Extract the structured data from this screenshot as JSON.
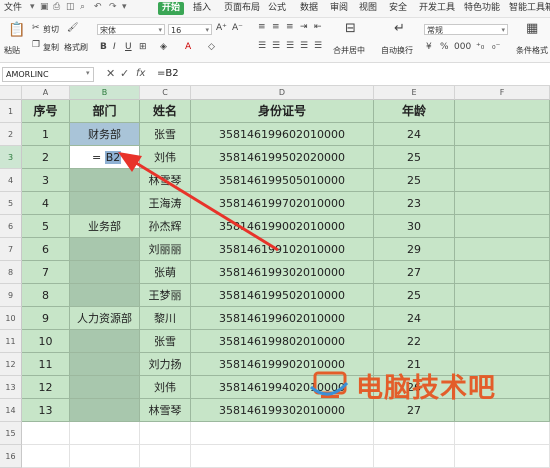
{
  "menubar": {
    "items": [
      "文件",
      "开始",
      "插入",
      "页面布局",
      "公式",
      "数据",
      "审阅",
      "视图",
      "安全",
      "开发工具",
      "特色功能",
      "智能工具箱"
    ],
    "active": "开始"
  },
  "ribbon": {
    "cut": "剪切",
    "copy": "复制",
    "paste": "粘贴",
    "format_painter": "格式刷",
    "font_name": "宋体",
    "font_size": "16",
    "merge_center": "合并居中",
    "wrap_text": "自动换行",
    "number_format": "常规",
    "conditional_format": "条件格式"
  },
  "formula_bar": {
    "name_box": "AMORLINC",
    "fx": "fx",
    "formula": "=B2"
  },
  "columns": [
    "A",
    "B",
    "C",
    "D",
    "E",
    "F"
  ],
  "rows": [
    "1",
    "2",
    "3",
    "4",
    "5",
    "6",
    "7",
    "8",
    "9",
    "10",
    "11",
    "12",
    "13",
    "14",
    "15",
    "16"
  ],
  "table": {
    "headers": [
      "序号",
      "部门",
      "姓名",
      "身份证号",
      "年龄"
    ],
    "seq": [
      "1",
      "2",
      "3",
      "4",
      "5",
      "6",
      "7",
      "8",
      "9",
      "10",
      "11",
      "12",
      "13"
    ],
    "dept": [
      "财务部",
      "",
      "",
      "",
      "业务部",
      "",
      "",
      "",
      "人力资源部",
      "",
      "",
      "",
      ""
    ],
    "names": [
      "张雪",
      "刘伟",
      "林雪琴",
      "王海涛",
      "孙杰辉",
      "刘丽丽",
      "张萌",
      "王梦丽",
      "黎川",
      "张雪",
      "刘力扬",
      "刘伟",
      "林雪琴"
    ],
    "ids": [
      "358146199602010000",
      "358146199502020000",
      "358146199505010000",
      "358146199702010000",
      "358146199002010000",
      "358146199102010000",
      "358146199302010000",
      "358146199502010000",
      "358146199602010000",
      "358146199802010000",
      "358146199902010000",
      "358146199402010000",
      "358146199302010000"
    ],
    "ages": [
      "24",
      "25",
      "25",
      "23",
      "30",
      "29",
      "27",
      "25",
      "24",
      "22",
      "21",
      "26",
      "27"
    ]
  },
  "editing_cell": {
    "prefix": "= ",
    "ref": "B2"
  },
  "watermark": {
    "text": "电脑技术吧"
  },
  "colors": {
    "table_fill": "#c7e5c8",
    "merged_fill": "#a8c7ad",
    "arrow": "#e8332a",
    "start_tab": "#3aa655",
    "watermark": "#e35d2a"
  }
}
